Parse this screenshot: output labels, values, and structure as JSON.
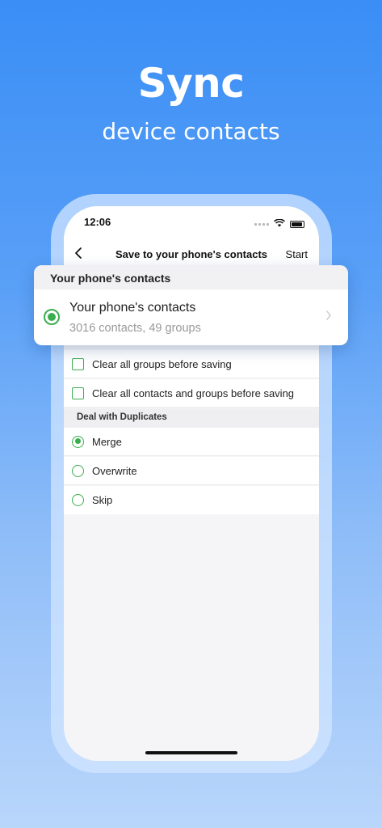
{
  "hero": {
    "title": "Sync",
    "subtitle": "device contacts"
  },
  "status_bar": {
    "time": "12:06",
    "icons": [
      "signal-icon",
      "wifi-icon",
      "battery-icon"
    ]
  },
  "nav": {
    "back_icon": "chevron-left-icon",
    "title": "Save to your phone's contacts",
    "start_label": "Start"
  },
  "popover": {
    "header": "Your phone's contacts",
    "item_title": "Your phone's contacts",
    "item_subtitle": "3016 contacts, 49 groups",
    "selected": true
  },
  "options": [
    {
      "label": "Clear all groups before saving",
      "checked": false
    },
    {
      "label": "Clear all contacts and groups before saving",
      "checked": false
    }
  ],
  "duplicates": {
    "header": "Deal with Duplicates",
    "choices": [
      {
        "label": "Merge",
        "selected": true
      },
      {
        "label": "Overwrite",
        "selected": false
      },
      {
        "label": "Skip",
        "selected": false
      }
    ]
  },
  "colors": {
    "accent_green": "#3aae4e",
    "background_blue": "#3a8ef6"
  }
}
